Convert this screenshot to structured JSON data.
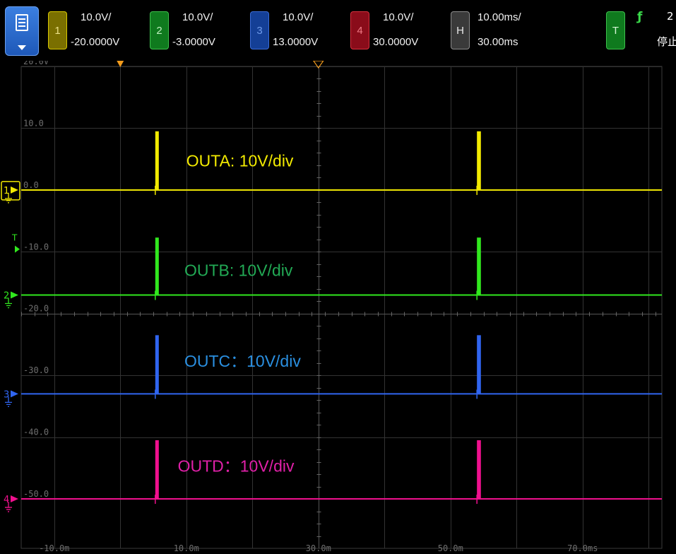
{
  "toolbar": {
    "channels": [
      {
        "num": "1",
        "scale": "10.0V/",
        "offset": "-20.0000V",
        "box_bg": "#7a6f00",
        "box_border": "#d8c800",
        "box_text": "#ece28a"
      },
      {
        "num": "2",
        "scale": "10.0V/",
        "offset": "-3.0000V",
        "box_bg": "#0f7a1e",
        "box_border": "#3cc04c",
        "box_text": "#bff0bf"
      },
      {
        "num": "3",
        "scale": "10.0V/",
        "offset": "13.0000V",
        "box_bg": "#143f96",
        "box_border": "#3a6cd8",
        "box_text": "#6f9bea"
      },
      {
        "num": "4",
        "scale": "10.0V/",
        "offset": "30.0000V",
        "box_bg": "#8a0c1a",
        "box_border": "#d8303e",
        "box_text": "#f07a85"
      },
      {
        "num": "H",
        "scale": "10.00ms/",
        "offset": "30.00ms",
        "box_bg": "#3a3a3a",
        "box_border": "#8c8c8c",
        "box_text": "#e8e8e8"
      }
    ],
    "trigger_label": "T",
    "trigger_edge": "ƒ",
    "trigger_level": "2",
    "run_state": "停止"
  },
  "chart_data": {
    "type": "line",
    "xlim": [
      -15,
      82
    ],
    "ylim": [
      -58,
      20
    ],
    "x_ticks": [
      -10,
      10,
      30,
      50,
      70
    ],
    "x_tick_labels": [
      "-10.0m",
      "10.0m",
      "30.0m",
      "50.0m",
      "70.0ms"
    ],
    "y_ticks": [
      20,
      10,
      0,
      -10,
      -20,
      -30,
      -40,
      -50
    ],
    "y_tick_labels": [
      "20.0V",
      "10.0",
      "0.0",
      "-10.0",
      "-20.0",
      "-30.0",
      "-40.0",
      "-50.0"
    ],
    "grid": true,
    "series": [
      {
        "name": "OUTA: 10V/div",
        "color": "#f2ea00",
        "baseline": 0.0,
        "high": 9.5,
        "pulses": [
          [
            5.3,
            5.7
          ],
          [
            54.0,
            54.6
          ]
        ],
        "label_x": 10.0,
        "label_y": 3.8,
        "label_color": "#f2ea00"
      },
      {
        "name": "OUTB: 10V/div",
        "color": "#31e81e",
        "baseline": -17.0,
        "high": -7.7,
        "pulses": [
          [
            5.3,
            5.7
          ],
          [
            54.0,
            54.6
          ]
        ],
        "label_x": 9.7,
        "label_y": -13.9,
        "label_color": "#22aa55"
      },
      {
        "name": "OUTC：10V/div",
        "color": "#3065f0",
        "baseline": -33.0,
        "high": -23.5,
        "pulses": [
          [
            5.3,
            5.7
          ],
          [
            54.0,
            54.6
          ]
        ],
        "label_x": 9.7,
        "label_y": -28.6,
        "label_color": "#2a8fe0"
      },
      {
        "name": "OUTD：10V/div",
        "color": "#f0108e",
        "baseline": -50.0,
        "high": -40.5,
        "pulses": [
          [
            5.3,
            5.7
          ],
          [
            54.0,
            54.6
          ]
        ],
        "label_x": 8.7,
        "label_y": -45.6,
        "label_color": "#e020a8"
      }
    ],
    "ground_markers": [
      "1",
      "2",
      "3",
      "4"
    ],
    "trigger_marker": "T",
    "trigger_level_y": -9.0
  }
}
